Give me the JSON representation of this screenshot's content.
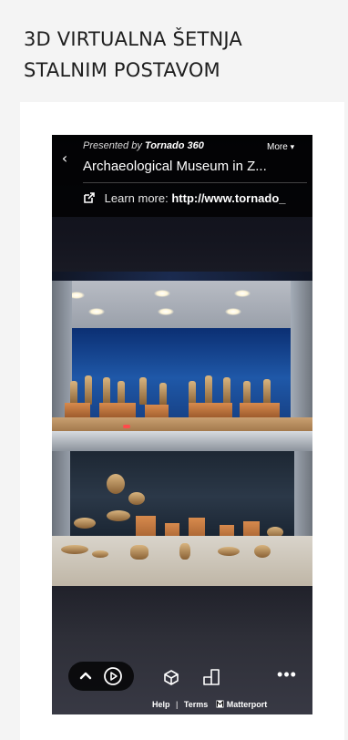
{
  "section": {
    "title": "3D VIRTUALNA ŠETNJA\nSTALNIM POSTAVOM"
  },
  "viewer": {
    "header": {
      "back_icon": "chevron-left-icon",
      "presented_prefix": "Presented by",
      "presented_brand": "Tornado 360",
      "more_label": "More",
      "more_icon": "chevron-down-icon",
      "venue_title": "Archaeological Museum in Z...",
      "learn_more_icon": "external-link-icon",
      "learn_more_label": "Learn more:",
      "learn_more_url": "http://www.tornado_"
    },
    "controls": {
      "collapse_icon": "chevron-up-icon",
      "play_icon": "play-circle-icon",
      "dollhouse_icon": "dollhouse-icon",
      "floorplan_icon": "floorplan-icon",
      "more_icon": "more-dots-icon",
      "more_glyph": "•••"
    },
    "footer": {
      "help_label": "Help",
      "separator": "|",
      "terms_label": "Terms",
      "brand_icon": "matterport-logo-icon",
      "brand_label": "Matterport"
    }
  },
  "colors": {
    "page_bg": "#f4f4f4",
    "card_bg": "#ffffff",
    "overlay_bg": "#000000",
    "title_text": "#1e1e1e"
  }
}
